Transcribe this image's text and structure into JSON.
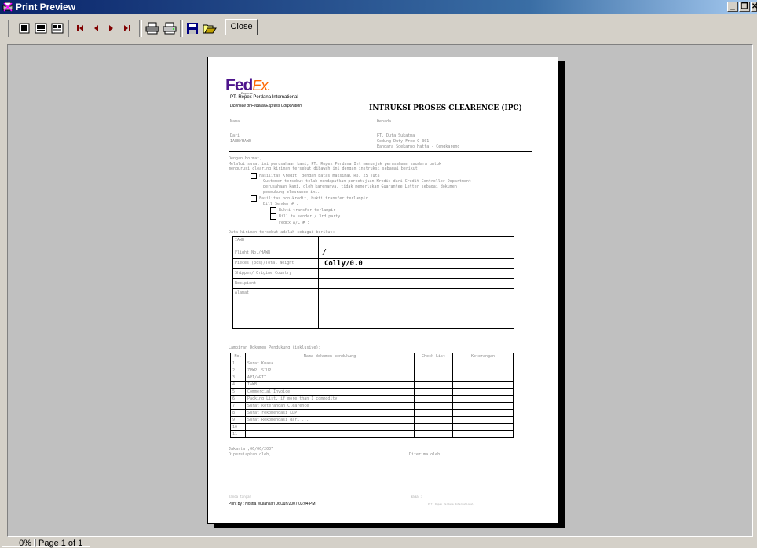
{
  "window": {
    "title": "Print Preview",
    "buttons": {
      "minimize": "_",
      "restore": "❐",
      "close": "✕"
    }
  },
  "toolbar": {
    "close_label": "Close",
    "icons": [
      "one-page-icon",
      "two-page-icon",
      "multi-page-icon",
      "first-page-icon",
      "prev-page-icon",
      "next-page-icon",
      "last-page-icon",
      "print-icon",
      "print-setup-icon",
      "save-icon",
      "open-icon"
    ]
  },
  "document": {
    "logo": {
      "fed": "Fed",
      "ex": "Ex.",
      "sub": "Express"
    },
    "company": "PT. Repex Perdana International",
    "licensee": "Licensee of Federal Express Corporation",
    "title": "INTRUKSI PROSES CLEARENCE (IPC)",
    "fields": {
      "nama": "Nama",
      "kepada": "Kepada",
      "dari": "Dari",
      "awb": "IAWB/HAWB",
      "colon": ":",
      "recipient_lines": [
        "PT. Duta Sukatma",
        "Gedung Duty Free C-301",
        "Bandara Soekarno Hatta - Cengkareng"
      ]
    },
    "salutation": "Dengan Hormat,",
    "intro1": "Melalui surat ini perusahaan kami, PT. Repex Perdana Int menunjuk perusahaan saudara untuk",
    "intro2": "mengurusi clearing kiriman tersebut dibawah ini dengan instruksi sebagai berikut:",
    "opt1": "Fasilitas Kredit, dengan batas maksimal Rp. 25 juta",
    "opt1_d1": "Customer tersebut telah mendapatkan persetujuan Kredit dari Credit Controller Department",
    "opt1_d2": "perusahaan kami, oleh karenanya, tidak memerlukan Guarantee Letter sebagai dokumen",
    "opt1_d3": "pendukung clearance ini.",
    "opt2": "Fasilitas non-kredit, bukti transfer terlampir",
    "opt2_bill": "Bill Sender # :",
    "opt2_a": "Bukti transfer terlampir",
    "opt2_b": "Bill to sender / 3rd party",
    "opt2_c": "FedEx A/C # :",
    "data_intro": "Data kiriman tersebut adalah sebagai berikut:",
    "ship_rows": {
      "r1": "IAWB",
      "r2": "Flight No./HAWB",
      "r3": "Pieces (pcs)/Total Weight",
      "r4": "Shipper/ Origine Country",
      "r5": "Recipient",
      "r6": "Alamat"
    },
    "slash": "/",
    "colly": "Colly/0.0",
    "lampiran_title": "Lampiran Dokumen Pendukung (inklusive):",
    "lampiran": {
      "headers": [
        "No.",
        "Nama dokumen pendukung",
        "Check List",
        "Keterangan"
      ],
      "rows": [
        [
          "1",
          "Surat Kuasa"
        ],
        [
          "2",
          "ZPWP, SIUP"
        ],
        [
          "3",
          "API/APIT"
        ],
        [
          "4",
          "IAWB"
        ],
        [
          "5",
          "Commercial Invoice"
        ],
        [
          "6",
          "Packing List, if more than 1 commodity"
        ],
        [
          "7",
          "Surat keterangan Clearence"
        ],
        [
          "8",
          "Surat rekomendasi LDP"
        ],
        [
          "9",
          "Surat Rekomendasi dari ..."
        ],
        [
          "10",
          ""
        ],
        [
          "11",
          ""
        ]
      ]
    },
    "place_date": "Jakarta ,06/06/2007",
    "prepared_by": "Dipersiapkan oleh,",
    "received_by": "Diterima oleh,",
    "footer_left_small": "Tanda tangan",
    "footer_right_small": "Nama :",
    "footer_right_small2": "P.T. Repex Perdana International",
    "printby": "Print by : Nostia Wulansari 06/Jun/2007 03:04 PM"
  },
  "status": {
    "zoom": "0%",
    "page": "Page 1 of 1"
  }
}
